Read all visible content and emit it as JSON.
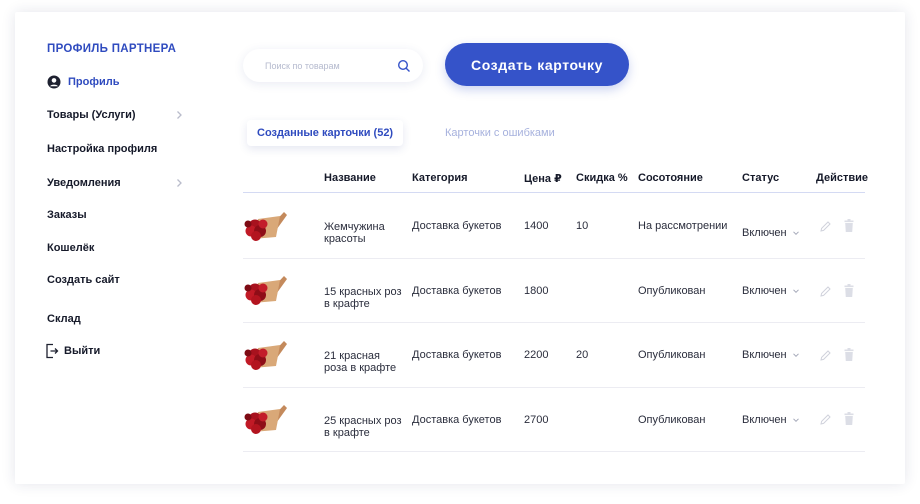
{
  "sidebar": {
    "title": "ПРОФИЛЬ ПАРТНЕРА",
    "items": [
      {
        "label": "Профиль",
        "icon": "user-circle-icon",
        "active": true
      },
      {
        "label": "Товары (Услуги)",
        "has_submenu": true
      },
      {
        "label": "Настройка профиля"
      },
      {
        "label": "Уведомления",
        "has_submenu": true
      },
      {
        "label": "Заказы"
      },
      {
        "label": "Кошелёк"
      },
      {
        "label": "Создать сайт"
      },
      {
        "label": "Склад"
      },
      {
        "label": "Выйти",
        "icon": "logout-icon"
      }
    ]
  },
  "search": {
    "placeholder": "Поиск по товарам",
    "value": "",
    "icon": "search-icon"
  },
  "create_button": {
    "label": "Создать карточку"
  },
  "tabs": [
    {
      "label": "Созданные карточки (52)",
      "active": true
    },
    {
      "label": "Карточки с ошибками",
      "active": false
    }
  ],
  "table": {
    "columns": [
      "Название",
      "Категория",
      "Цена ₽",
      "Скидка %",
      "Сосотояние",
      "Статус",
      "Действие"
    ],
    "rows": [
      {
        "name": "Жемчужина красоты",
        "category": "Доставка букетов",
        "price": "1400",
        "discount": "10",
        "state": "На рассмотрении",
        "status": "Включен"
      },
      {
        "name": "15 красных роз в крафте",
        "category": "Доставка букетов",
        "price": "1800",
        "discount": "",
        "state": "Опубликован",
        "status": "Включен"
      },
      {
        "name": "21 красная роза в крафте",
        "category": "Доставка букетов",
        "price": "2200",
        "discount": "20",
        "state": "Опубликован",
        "status": "Включен"
      },
      {
        "name": "25 красных роз в крафте",
        "category": "Доставка букетов",
        "price": "2700",
        "discount": "",
        "state": "Опубликован",
        "status": "Включен"
      }
    ]
  },
  "colors": {
    "accent": "#3553c9",
    "inactive_tab": "#a6b1dd",
    "text": "#161a2a",
    "icon_muted": "#c9cbd6"
  }
}
